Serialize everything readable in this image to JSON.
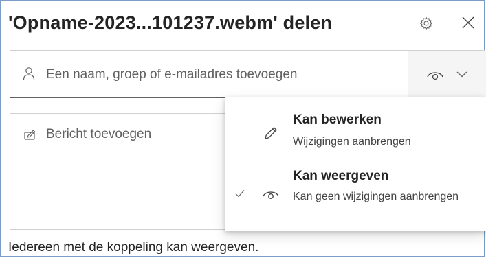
{
  "dialog": {
    "title": "'Opname-2023...101237.webm' delen",
    "icons": {
      "settings": "gear-icon",
      "close": "close-icon"
    }
  },
  "recipients": {
    "placeholder": "Een naam, groep of e-mailadres toevoegen",
    "icon": "person-icon",
    "permission_icon": "eye-icon",
    "dropdown_icon": "chevron-down-icon"
  },
  "message": {
    "placeholder": "Bericht toevoegen",
    "icon": "message-edit-icon"
  },
  "permission_menu": {
    "items": [
      {
        "title": "Kan bewerken",
        "description": "Wijzigingen aanbrengen",
        "icon": "pencil-icon",
        "selected": false
      },
      {
        "title": "Kan weergeven",
        "description": "Kan geen wijzigingen aanbrengen",
        "icon": "eye-icon",
        "selected": true
      }
    ]
  },
  "link_info": "Iedereen met de koppeling kan weergeven.",
  "colors": {
    "border": "#d1d1d1",
    "text": "#242424",
    "muted": "#616161",
    "frame": "#7a9cc6"
  }
}
